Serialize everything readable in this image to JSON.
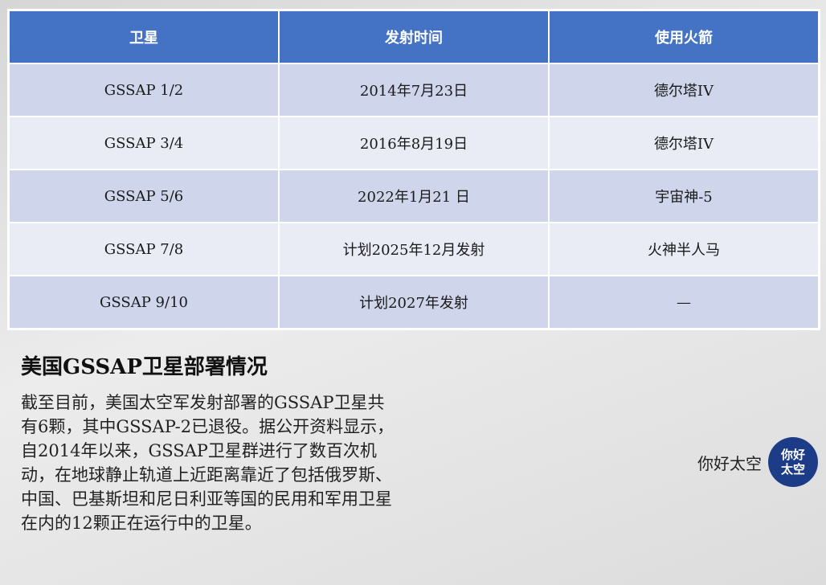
{
  "table": {
    "headers": [
      "卫星",
      "发射时间",
      "使用火箭"
    ],
    "rows": [
      [
        "GSSAP 1/2",
        "2014年7月23日",
        "德尔塔IV"
      ],
      [
        "GSSAP 3/4",
        "2016年8月19日",
        "德尔塔IV"
      ],
      [
        "GSSAP 5/6",
        "2022年1月21 日",
        "宇宙神-5"
      ],
      [
        "GSSAP 7/8",
        "计划2025年12月发射",
        "火神半人马"
      ],
      [
        "GSSAP 9/10",
        "计划2027年发射",
        "—"
      ]
    ]
  },
  "article": {
    "title": "美国GSSAP卫星部署情况",
    "body": "截至目前，美国太空军发射部署的GSSAP卫星共有6颗，其中GSSAP-2已退役。据公开资料显示，自2014年以来，GSSAP卫星群进行了数百次机动，在地球静止轨道上近距离靠近了包括俄罗斯、中国、巴基斯坦和尼日利亚等国的民用和军用卫星在内的12颗正在运行中的卫星。"
  },
  "brand": {
    "name": "你好太空",
    "logo_line1": "你好",
    "logo_line2": "太空"
  },
  "colors": {
    "header_bg": "#4472c4",
    "row_odd": "#cfd5ea",
    "row_even": "#e9ebf5",
    "logo_bg": "#1d3c87"
  }
}
